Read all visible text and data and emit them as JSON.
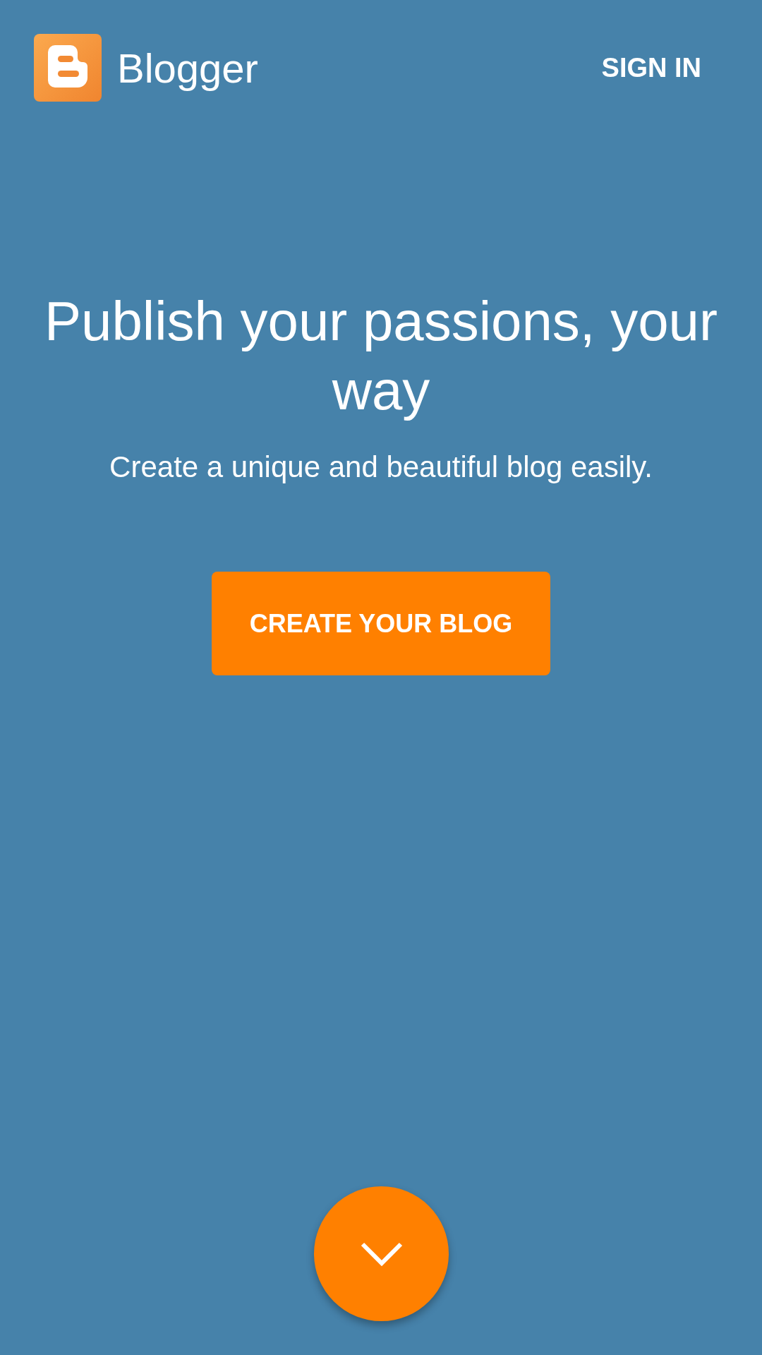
{
  "header": {
    "brand": "Blogger",
    "sign_in": "SIGN IN"
  },
  "hero": {
    "title": "Publish your passions, your way",
    "subtitle": "Create a unique and beautiful blog easily.",
    "cta": "CREATE YOUR BLOG"
  }
}
